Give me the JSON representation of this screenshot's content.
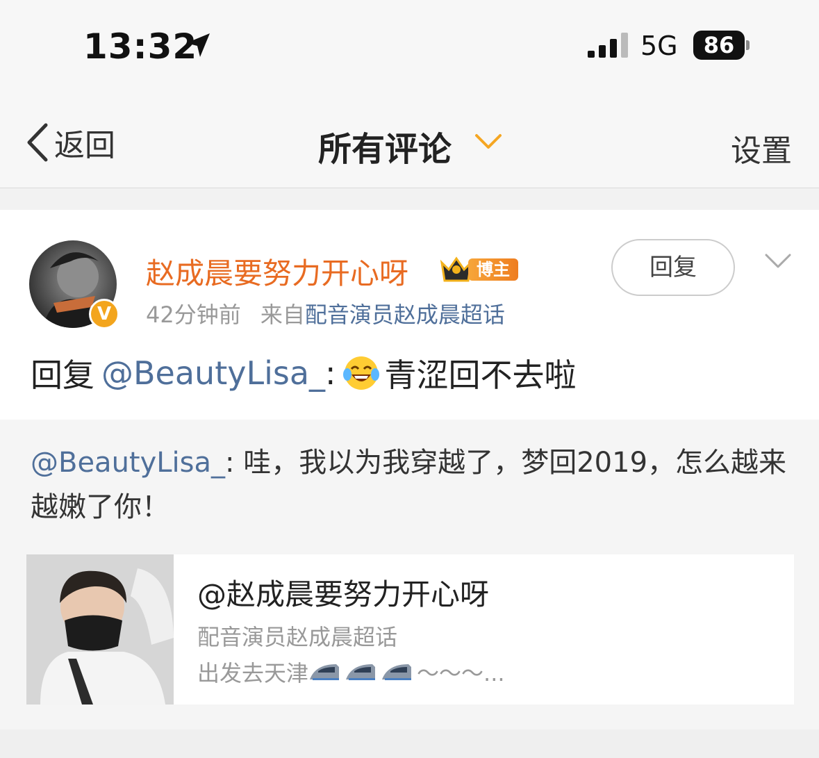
{
  "status_bar": {
    "time": "13:32",
    "network": "5G",
    "battery": "86",
    "icons": [
      "location-arrow-icon",
      "signal-bars-icon",
      "battery-icon"
    ]
  },
  "nav": {
    "back_label": "返回",
    "title": "所有评论",
    "settings_label": "设置",
    "colors": {
      "accent": "#f5a623"
    }
  },
  "comment": {
    "username": "赵成晨要努力开心呀",
    "badge_label": "博主",
    "verified_mark": "V",
    "time_ago": "42分钟前",
    "source_prefix": "来自",
    "source_link": "配音演员赵成晨超话",
    "reply_button": "回复",
    "reply_prefix": "回复",
    "reply_mention": "@BeautyLisa_",
    "reply_colon": ":",
    "reply_body": "青涩回不去啦",
    "emoji": "laughing-tears-emoji",
    "colors": {
      "username": "#e86b22",
      "link": "#4f6f9a"
    }
  },
  "quoted": {
    "mention": "@BeautyLisa_",
    "text": ": 哇，我以为我穿越了，梦回2019，怎么越来越嫩了你！",
    "share": {
      "title": "@赵成晨要努力开心呀",
      "subtitle": "配音演员赵成晨超话",
      "desc_prefix": "出发去天津",
      "desc_suffix": "～～～...",
      "icons": [
        "bullet-train-icon",
        "bullet-train-icon",
        "bullet-train-icon"
      ]
    }
  }
}
